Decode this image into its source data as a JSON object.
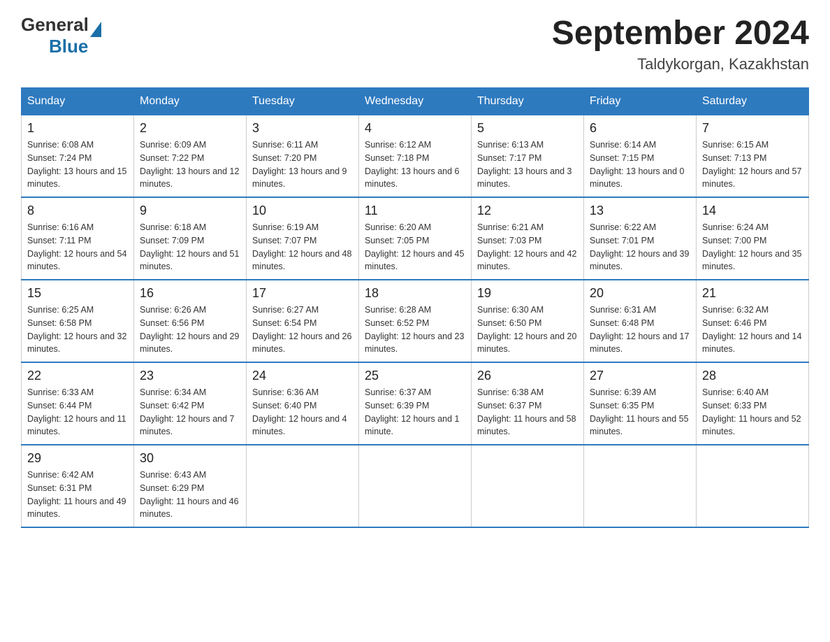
{
  "header": {
    "logo_general": "General",
    "logo_blue": "Blue",
    "month_year": "September 2024",
    "location": "Taldykorgan, Kazakhstan"
  },
  "columns": [
    "Sunday",
    "Monday",
    "Tuesday",
    "Wednesday",
    "Thursday",
    "Friday",
    "Saturday"
  ],
  "weeks": [
    [
      {
        "day": "1",
        "sunrise": "6:08 AM",
        "sunset": "7:24 PM",
        "daylight": "13 hours and 15 minutes."
      },
      {
        "day": "2",
        "sunrise": "6:09 AM",
        "sunset": "7:22 PM",
        "daylight": "13 hours and 12 minutes."
      },
      {
        "day": "3",
        "sunrise": "6:11 AM",
        "sunset": "7:20 PM",
        "daylight": "13 hours and 9 minutes."
      },
      {
        "day": "4",
        "sunrise": "6:12 AM",
        "sunset": "7:18 PM",
        "daylight": "13 hours and 6 minutes."
      },
      {
        "day": "5",
        "sunrise": "6:13 AM",
        "sunset": "7:17 PM",
        "daylight": "13 hours and 3 minutes."
      },
      {
        "day": "6",
        "sunrise": "6:14 AM",
        "sunset": "7:15 PM",
        "daylight": "13 hours and 0 minutes."
      },
      {
        "day": "7",
        "sunrise": "6:15 AM",
        "sunset": "7:13 PM",
        "daylight": "12 hours and 57 minutes."
      }
    ],
    [
      {
        "day": "8",
        "sunrise": "6:16 AM",
        "sunset": "7:11 PM",
        "daylight": "12 hours and 54 minutes."
      },
      {
        "day": "9",
        "sunrise": "6:18 AM",
        "sunset": "7:09 PM",
        "daylight": "12 hours and 51 minutes."
      },
      {
        "day": "10",
        "sunrise": "6:19 AM",
        "sunset": "7:07 PM",
        "daylight": "12 hours and 48 minutes."
      },
      {
        "day": "11",
        "sunrise": "6:20 AM",
        "sunset": "7:05 PM",
        "daylight": "12 hours and 45 minutes."
      },
      {
        "day": "12",
        "sunrise": "6:21 AM",
        "sunset": "7:03 PM",
        "daylight": "12 hours and 42 minutes."
      },
      {
        "day": "13",
        "sunrise": "6:22 AM",
        "sunset": "7:01 PM",
        "daylight": "12 hours and 39 minutes."
      },
      {
        "day": "14",
        "sunrise": "6:24 AM",
        "sunset": "7:00 PM",
        "daylight": "12 hours and 35 minutes."
      }
    ],
    [
      {
        "day": "15",
        "sunrise": "6:25 AM",
        "sunset": "6:58 PM",
        "daylight": "12 hours and 32 minutes."
      },
      {
        "day": "16",
        "sunrise": "6:26 AM",
        "sunset": "6:56 PM",
        "daylight": "12 hours and 29 minutes."
      },
      {
        "day": "17",
        "sunrise": "6:27 AM",
        "sunset": "6:54 PM",
        "daylight": "12 hours and 26 minutes."
      },
      {
        "day": "18",
        "sunrise": "6:28 AM",
        "sunset": "6:52 PM",
        "daylight": "12 hours and 23 minutes."
      },
      {
        "day": "19",
        "sunrise": "6:30 AM",
        "sunset": "6:50 PM",
        "daylight": "12 hours and 20 minutes."
      },
      {
        "day": "20",
        "sunrise": "6:31 AM",
        "sunset": "6:48 PM",
        "daylight": "12 hours and 17 minutes."
      },
      {
        "day": "21",
        "sunrise": "6:32 AM",
        "sunset": "6:46 PM",
        "daylight": "12 hours and 14 minutes."
      }
    ],
    [
      {
        "day": "22",
        "sunrise": "6:33 AM",
        "sunset": "6:44 PM",
        "daylight": "12 hours and 11 minutes."
      },
      {
        "day": "23",
        "sunrise": "6:34 AM",
        "sunset": "6:42 PM",
        "daylight": "12 hours and 7 minutes."
      },
      {
        "day": "24",
        "sunrise": "6:36 AM",
        "sunset": "6:40 PM",
        "daylight": "12 hours and 4 minutes."
      },
      {
        "day": "25",
        "sunrise": "6:37 AM",
        "sunset": "6:39 PM",
        "daylight": "12 hours and 1 minute."
      },
      {
        "day": "26",
        "sunrise": "6:38 AM",
        "sunset": "6:37 PM",
        "daylight": "11 hours and 58 minutes."
      },
      {
        "day": "27",
        "sunrise": "6:39 AM",
        "sunset": "6:35 PM",
        "daylight": "11 hours and 55 minutes."
      },
      {
        "day": "28",
        "sunrise": "6:40 AM",
        "sunset": "6:33 PM",
        "daylight": "11 hours and 52 minutes."
      }
    ],
    [
      {
        "day": "29",
        "sunrise": "6:42 AM",
        "sunset": "6:31 PM",
        "daylight": "11 hours and 49 minutes."
      },
      {
        "day": "30",
        "sunrise": "6:43 AM",
        "sunset": "6:29 PM",
        "daylight": "11 hours and 46 minutes."
      },
      null,
      null,
      null,
      null,
      null
    ]
  ]
}
